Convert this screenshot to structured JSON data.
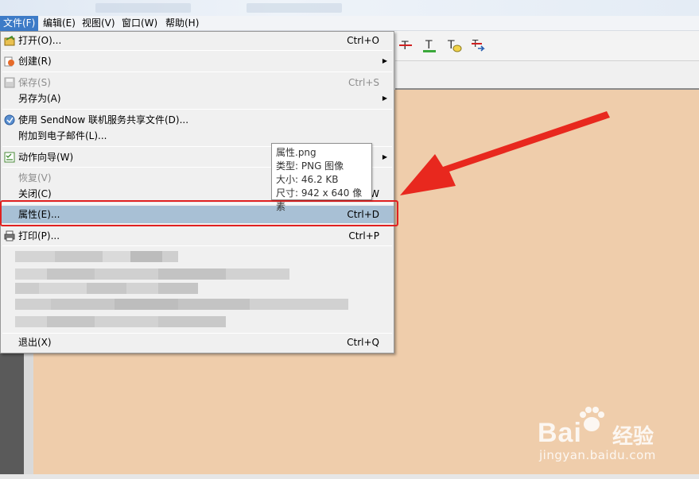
{
  "menubar": {
    "items": [
      {
        "label": "文件(F)",
        "active": true
      },
      {
        "label": "编辑(E)",
        "active": false
      },
      {
        "label": "视图(V)",
        "active": false
      },
      {
        "label": "窗口(W)",
        "active": false
      },
      {
        "label": "帮助(H)",
        "active": false
      }
    ]
  },
  "file_menu": {
    "items": [
      {
        "id": "open",
        "label": "打开(O)...",
        "shortcut": "Ctrl+O",
        "icon": "open-folder-icon"
      },
      {
        "id": "create",
        "label": "创建(R)",
        "submenu": true,
        "icon": "create-icon"
      },
      {
        "id": "save",
        "label": "保存(S)",
        "shortcut": "Ctrl+S",
        "disabled": true,
        "icon": "save-icon"
      },
      {
        "id": "save-as",
        "label": "另存为(A)",
        "submenu": true
      },
      {
        "id": "sendnow",
        "label": "使用 SendNow 联机服务共享文件(D)...",
        "icon": "sendnow-icon"
      },
      {
        "id": "attach-email",
        "label": "附加到电子邮件(L)..."
      },
      {
        "id": "action-wizard",
        "label": "动作向导(W)",
        "submenu": true,
        "icon": "action-wizard-icon"
      },
      {
        "id": "revert",
        "label": "恢复(V)",
        "disabled": true
      },
      {
        "id": "close",
        "label": "关闭(C)",
        "shortcut": "W"
      },
      {
        "id": "properties",
        "label": "属性(E)...",
        "shortcut": "Ctrl+D",
        "highlighted": true
      },
      {
        "id": "print",
        "label": "打印(P)...",
        "shortcut": "Ctrl+P",
        "icon": "printer-icon"
      },
      {
        "id": "exit",
        "label": "退出(X)",
        "shortcut": "Ctrl+Q"
      }
    ]
  },
  "tooltip": {
    "name": "属性.png",
    "type": "类型: PNG 图像",
    "size": "大小: 46.2 KB",
    "dimensions": "尺寸: 942 x 640 像素"
  },
  "watermark": {
    "brand": "Bai",
    "brand_suffix": "经验",
    "url": "jingyan.baidu.com"
  },
  "colors": {
    "menubar_active": "#3d7bc7",
    "highlight": "#a8c0d5",
    "annotation_red": "#e02020",
    "document_bg": "#efcdab"
  }
}
